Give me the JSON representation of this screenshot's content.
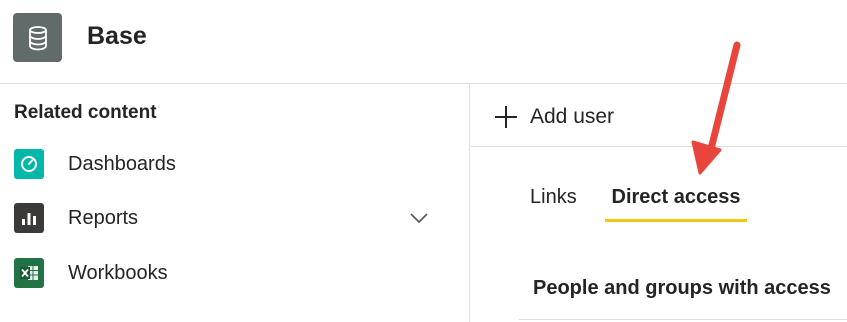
{
  "header": {
    "title": "Base",
    "icon": "database-icon"
  },
  "sidebar": {
    "title": "Related content",
    "items": [
      {
        "label": "Dashboards",
        "icon": "dashboard-gauge-icon",
        "color": "#00b7a8"
      },
      {
        "label": "Reports",
        "icon": "bar-chart-icon",
        "color": "#3b3a39",
        "expandable": true
      },
      {
        "label": "Workbooks",
        "icon": "excel-icon",
        "color": "#217346"
      }
    ]
  },
  "panel": {
    "add_user_label": "Add user",
    "tabs": [
      {
        "label": "Links",
        "active": false
      },
      {
        "label": "Direct access",
        "active": true
      }
    ],
    "section_title": "People and groups with access"
  },
  "colors": {
    "accent_underline": "#f2c811",
    "annotation_arrow": "#e8453c",
    "app_icon_bg": "#616b6a"
  }
}
